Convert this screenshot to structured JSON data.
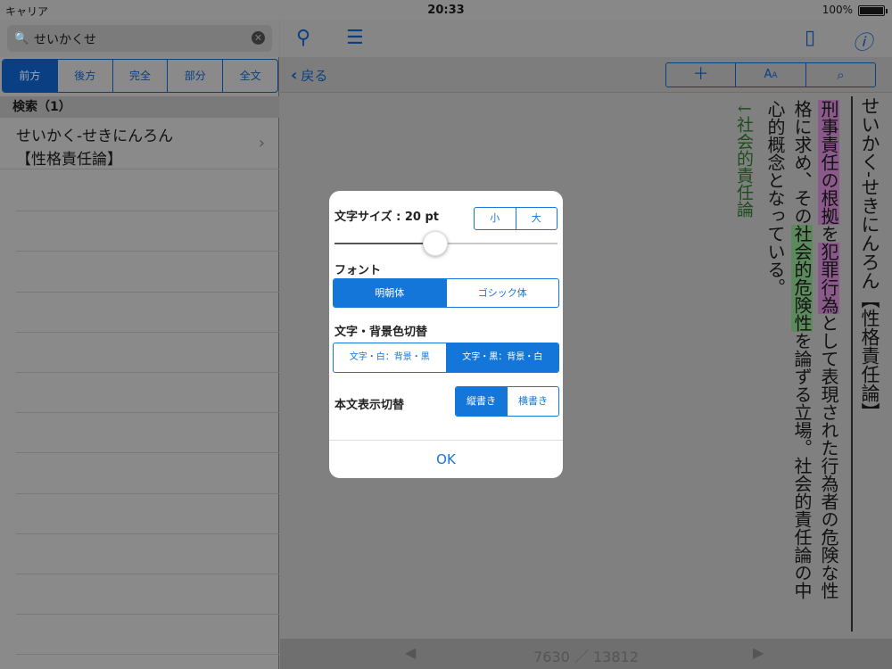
{
  "status": {
    "carrier": "キャリア",
    "time": "20:33",
    "battery": "100%",
    "battery_level": 1.0
  },
  "search": {
    "query": "せいかくせ"
  },
  "segments": [
    "前方",
    "後方",
    "完全",
    "部分",
    "全文"
  ],
  "results": {
    "header": "検索（1）",
    "items": [
      {
        "line1": "せいかく-せきにんろん",
        "line2": "【性格責任論】"
      }
    ]
  },
  "nav": {
    "back_label": "戻る"
  },
  "entry": {
    "title": "せいかく-せきにんろん【性格責任論】",
    "text_part1": "",
    "hl1": "刑事責任の根拠",
    "text_part2": "を",
    "hl2": "犯罪行為",
    "text_part3": "として表現された行為者の危険な性格に求め、その",
    "hl3": "社会的危険性",
    "text_part4": "を論ずる立場。社会的責任論の中心的概念となっている。",
    "link": "↓社会的責任論"
  },
  "pager": {
    "current": "7630",
    "sep": "／",
    "total": "13812"
  },
  "dialog": {
    "font_size_label": "文字サイズ : 20 pt",
    "size_small": "小",
    "size_large": "大",
    "font_size_level": 0.45,
    "font_label": "フォント",
    "font_options": [
      "明朝体",
      "ゴシック体"
    ],
    "color_label": "文字・背景色切替",
    "color_options": [
      "文字・白：背景・黒",
      "文字・黒：背景・白"
    ],
    "layout_label": "本文表示切替",
    "layout_options": [
      "縦書き",
      "横書き"
    ],
    "ok": "OK"
  },
  "colors": {
    "accent": "#1576d9",
    "highlight_pink": "#8a5a8a",
    "highlight_green": "#5c8a5c"
  }
}
